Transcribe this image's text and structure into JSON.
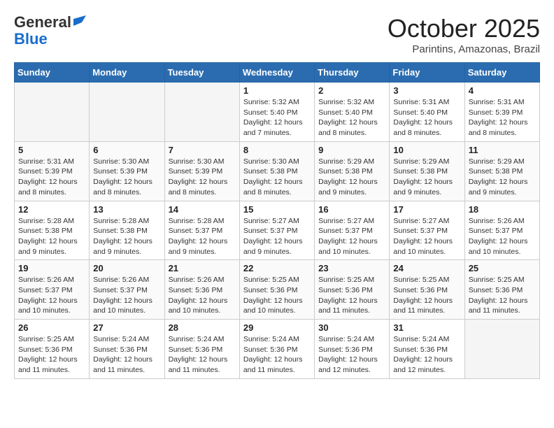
{
  "logo": {
    "line1": "General",
    "line2": "Blue"
  },
  "title": "October 2025",
  "location": "Parintins, Amazonas, Brazil",
  "weekdays": [
    "Sunday",
    "Monday",
    "Tuesday",
    "Wednesday",
    "Thursday",
    "Friday",
    "Saturday"
  ],
  "weeks": [
    [
      {
        "day": "",
        "info": ""
      },
      {
        "day": "",
        "info": ""
      },
      {
        "day": "",
        "info": ""
      },
      {
        "day": "1",
        "info": "Sunrise: 5:32 AM\nSunset: 5:40 PM\nDaylight: 12 hours\nand 7 minutes."
      },
      {
        "day": "2",
        "info": "Sunrise: 5:32 AM\nSunset: 5:40 PM\nDaylight: 12 hours\nand 8 minutes."
      },
      {
        "day": "3",
        "info": "Sunrise: 5:31 AM\nSunset: 5:40 PM\nDaylight: 12 hours\nand 8 minutes."
      },
      {
        "day": "4",
        "info": "Sunrise: 5:31 AM\nSunset: 5:39 PM\nDaylight: 12 hours\nand 8 minutes."
      }
    ],
    [
      {
        "day": "5",
        "info": "Sunrise: 5:31 AM\nSunset: 5:39 PM\nDaylight: 12 hours\nand 8 minutes."
      },
      {
        "day": "6",
        "info": "Sunrise: 5:30 AM\nSunset: 5:39 PM\nDaylight: 12 hours\nand 8 minutes."
      },
      {
        "day": "7",
        "info": "Sunrise: 5:30 AM\nSunset: 5:39 PM\nDaylight: 12 hours\nand 8 minutes."
      },
      {
        "day": "8",
        "info": "Sunrise: 5:30 AM\nSunset: 5:38 PM\nDaylight: 12 hours\nand 8 minutes."
      },
      {
        "day": "9",
        "info": "Sunrise: 5:29 AM\nSunset: 5:38 PM\nDaylight: 12 hours\nand 9 minutes."
      },
      {
        "day": "10",
        "info": "Sunrise: 5:29 AM\nSunset: 5:38 PM\nDaylight: 12 hours\nand 9 minutes."
      },
      {
        "day": "11",
        "info": "Sunrise: 5:29 AM\nSunset: 5:38 PM\nDaylight: 12 hours\nand 9 minutes."
      }
    ],
    [
      {
        "day": "12",
        "info": "Sunrise: 5:28 AM\nSunset: 5:38 PM\nDaylight: 12 hours\nand 9 minutes."
      },
      {
        "day": "13",
        "info": "Sunrise: 5:28 AM\nSunset: 5:38 PM\nDaylight: 12 hours\nand 9 minutes."
      },
      {
        "day": "14",
        "info": "Sunrise: 5:28 AM\nSunset: 5:37 PM\nDaylight: 12 hours\nand 9 minutes."
      },
      {
        "day": "15",
        "info": "Sunrise: 5:27 AM\nSunset: 5:37 PM\nDaylight: 12 hours\nand 9 minutes."
      },
      {
        "day": "16",
        "info": "Sunrise: 5:27 AM\nSunset: 5:37 PM\nDaylight: 12 hours\nand 10 minutes."
      },
      {
        "day": "17",
        "info": "Sunrise: 5:27 AM\nSunset: 5:37 PM\nDaylight: 12 hours\nand 10 minutes."
      },
      {
        "day": "18",
        "info": "Sunrise: 5:26 AM\nSunset: 5:37 PM\nDaylight: 12 hours\nand 10 minutes."
      }
    ],
    [
      {
        "day": "19",
        "info": "Sunrise: 5:26 AM\nSunset: 5:37 PM\nDaylight: 12 hours\nand 10 minutes."
      },
      {
        "day": "20",
        "info": "Sunrise: 5:26 AM\nSunset: 5:37 PM\nDaylight: 12 hours\nand 10 minutes."
      },
      {
        "day": "21",
        "info": "Sunrise: 5:26 AM\nSunset: 5:36 PM\nDaylight: 12 hours\nand 10 minutes."
      },
      {
        "day": "22",
        "info": "Sunrise: 5:25 AM\nSunset: 5:36 PM\nDaylight: 12 hours\nand 10 minutes."
      },
      {
        "day": "23",
        "info": "Sunrise: 5:25 AM\nSunset: 5:36 PM\nDaylight: 12 hours\nand 11 minutes."
      },
      {
        "day": "24",
        "info": "Sunrise: 5:25 AM\nSunset: 5:36 PM\nDaylight: 12 hours\nand 11 minutes."
      },
      {
        "day": "25",
        "info": "Sunrise: 5:25 AM\nSunset: 5:36 PM\nDaylight: 12 hours\nand 11 minutes."
      }
    ],
    [
      {
        "day": "26",
        "info": "Sunrise: 5:25 AM\nSunset: 5:36 PM\nDaylight: 12 hours\nand 11 minutes."
      },
      {
        "day": "27",
        "info": "Sunrise: 5:24 AM\nSunset: 5:36 PM\nDaylight: 12 hours\nand 11 minutes."
      },
      {
        "day": "28",
        "info": "Sunrise: 5:24 AM\nSunset: 5:36 PM\nDaylight: 12 hours\nand 11 minutes."
      },
      {
        "day": "29",
        "info": "Sunrise: 5:24 AM\nSunset: 5:36 PM\nDaylight: 12 hours\nand 11 minutes."
      },
      {
        "day": "30",
        "info": "Sunrise: 5:24 AM\nSunset: 5:36 PM\nDaylight: 12 hours\nand 12 minutes."
      },
      {
        "day": "31",
        "info": "Sunrise: 5:24 AM\nSunset: 5:36 PM\nDaylight: 12 hours\nand 12 minutes."
      },
      {
        "day": "",
        "info": ""
      }
    ]
  ]
}
